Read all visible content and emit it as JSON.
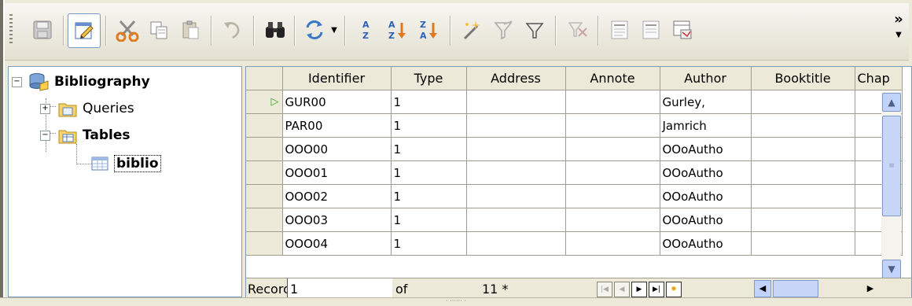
{
  "toolbar": {
    "buttons": [
      {
        "name": "save-button",
        "icon": "save-icon"
      },
      {
        "name": "edit-data-button",
        "icon": "pencil-doc-icon"
      },
      {
        "name": "cut-button",
        "icon": "scissors-icon"
      },
      {
        "name": "copy-button",
        "icon": "copy-icon"
      },
      {
        "name": "paste-button",
        "icon": "paste-icon"
      },
      {
        "name": "undo-button",
        "icon": "undo-icon"
      },
      {
        "name": "find-button",
        "icon": "binoculars-icon"
      },
      {
        "name": "refresh-button",
        "icon": "refresh-icon"
      },
      {
        "name": "sort-button",
        "icon": "sort-az-icon"
      },
      {
        "name": "sort-ascending-button",
        "icon": "sort-ascending-icon"
      },
      {
        "name": "sort-descending-button",
        "icon": "sort-descending-icon"
      },
      {
        "name": "autofilter-button",
        "icon": "magic-wand-icon"
      },
      {
        "name": "apply-filter-button",
        "icon": "filter-icon"
      },
      {
        "name": "standard-filter-button",
        "icon": "funnel-icon"
      },
      {
        "name": "remove-filter-button",
        "icon": "remove-filter-icon"
      },
      {
        "name": "text-button",
        "icon": "text-doc-icon"
      },
      {
        "name": "fields-button",
        "icon": "fields-doc-icon"
      },
      {
        "name": "datasource-button",
        "icon": "datasource-icon"
      }
    ],
    "more_label": "»"
  },
  "tree": {
    "root": "Bibliography",
    "queries": "Queries",
    "tables": "Tables",
    "table_item": "biblio"
  },
  "grid": {
    "columns": [
      "Identifier",
      "Type",
      "Address",
      "Annote",
      "Author",
      "Booktitle",
      "Chap"
    ],
    "rows": [
      {
        "identifier": "GUR00",
        "type": "1",
        "address": "",
        "annote": "",
        "author": "Gurley,",
        "booktitle": "",
        "current": true
      },
      {
        "identifier": "PAR00",
        "type": "1",
        "address": "",
        "annote": "",
        "author": "Jamrich",
        "booktitle": ""
      },
      {
        "identifier": "OOO00",
        "type": "1",
        "address": "",
        "annote": "",
        "author": "OOoAutho",
        "booktitle": ""
      },
      {
        "identifier": "OOO01",
        "type": "1",
        "address": "",
        "annote": "",
        "author": "OOoAutho",
        "booktitle": ""
      },
      {
        "identifier": "OOO02",
        "type": "1",
        "address": "",
        "annote": "",
        "author": "OOoAutho",
        "booktitle": ""
      },
      {
        "identifier": "OOO03",
        "type": "1",
        "address": "",
        "annote": "",
        "author": "OOoAutho",
        "booktitle": ""
      },
      {
        "identifier": "OOO04",
        "type": "1",
        "address": "",
        "annote": "",
        "author": "OOoAutho",
        "booktitle": ""
      }
    ]
  },
  "navigation": {
    "record_label": "Record",
    "record_value": "1",
    "of_label": "of",
    "total": "11 *"
  },
  "colors": {
    "current_row_arrow": "#3aa01d",
    "accent": "#7b9ac6"
  }
}
